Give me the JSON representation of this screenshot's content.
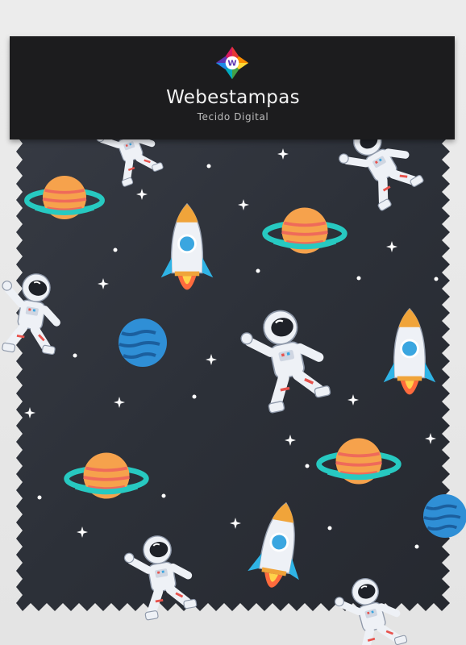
{
  "brand": {
    "name": "Webestampas",
    "tagline": "Tecido Digital",
    "logo_letter": "W"
  },
  "fabric": {
    "background_color": "#2f333b",
    "motifs": [
      "astronaut",
      "rocket",
      "ringed-planet",
      "blue-planet",
      "sparkle-star"
    ],
    "colors": {
      "planet_orange": "#f5a04a",
      "planet_stripe": "#ef6a5a",
      "ring_cyan": "#2fd0c8",
      "planet_blue": "#2f8fd6",
      "rocket_white": "#eef1f6",
      "flame": "#ff7a45",
      "header_black": "#1c1c1e"
    }
  }
}
